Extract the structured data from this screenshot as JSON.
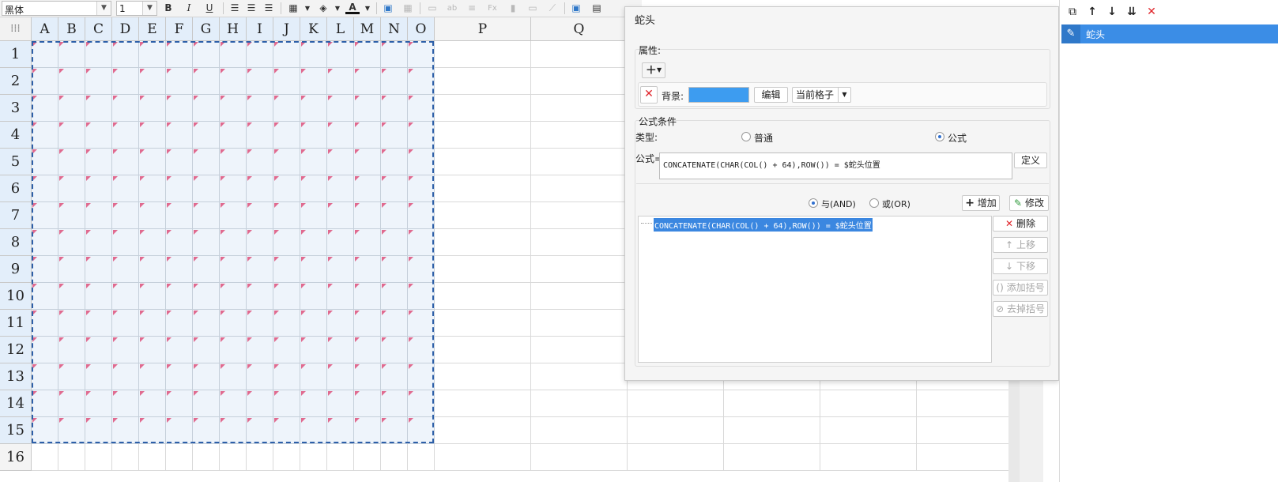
{
  "toolbar": {
    "font_name": "黑体",
    "font_size": "1",
    "icons": [
      "bold-icon",
      "italic-icon",
      "underline-icon",
      "align-left-icon",
      "align-center-icon",
      "align-right-icon",
      "border-icon",
      "fill-color-icon",
      "font-color-icon",
      "insert-image-icon",
      "merge-icon",
      "format-brush-icon",
      "text-icon",
      "wrap-icon",
      "formula-icon",
      "chart-icon",
      "image-icon",
      "link-icon",
      "freeze-icon",
      "sheet-icon"
    ]
  },
  "sheet": {
    "corner_icon": "grid-dots-icon",
    "columns": [
      "A",
      "B",
      "C",
      "D",
      "E",
      "F",
      "G",
      "H",
      "I",
      "J",
      "K",
      "L",
      "M",
      "N",
      "O",
      "P",
      "Q"
    ],
    "rows": [
      "1",
      "2",
      "3",
      "4",
      "5",
      "6",
      "7",
      "8",
      "9",
      "10",
      "11",
      "12",
      "13",
      "14",
      "15",
      "16"
    ]
  },
  "dialog": {
    "title": "蛇头",
    "attributes_label": "属性:",
    "add_label": "+",
    "background_label": "背景:",
    "background_color": "#3d9cf0",
    "edit_button": "编辑",
    "scope_select": "当前格子",
    "condition_group_label": "公式条件",
    "type_label": "类型:",
    "type_normal": "普通",
    "type_formula": "公式",
    "formula_label": "公式=",
    "formula_value": "CONCATENATE(CHAR(COL() + 64),ROW()) = $蛇头位置",
    "define_button": "定义",
    "and_label": "与(AND)",
    "or_label": "或(OR)",
    "add_button": "增加",
    "modify_button": "修改",
    "conditions": [
      "CONCATENATE(CHAR(COL() + 64),ROW()) = $蛇头位置"
    ],
    "delete_button": "删除",
    "move_up_button": "上移",
    "move_down_button": "下移",
    "add_bracket_button": "添加括号",
    "remove_bracket_button": "去掉括号"
  },
  "right_panel": {
    "toolbar_icons": [
      "copy-icon",
      "arrow-up-icon",
      "arrow-down-icon",
      "sort-icon",
      "delete-icon"
    ],
    "items": [
      "蛇头"
    ]
  }
}
